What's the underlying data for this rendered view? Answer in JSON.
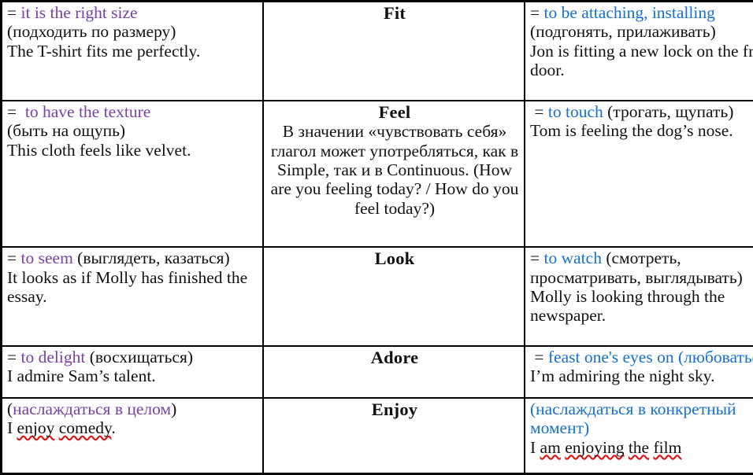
{
  "document": {
    "type": "table",
    "columns": 3,
    "rows": 5,
    "colors": {
      "purple": "#7b3fa6",
      "blue": "#1570cf",
      "text": "#111111",
      "border": "#000000",
      "spellcheck_underline": "#e01010",
      "background": "#ffffff"
    }
  },
  "rows": [
    {
      "verb": "Fit",
      "left": {
        "definition_prefix": "= ",
        "definition": "it is the right size",
        "translation": "(подходить по размеру)",
        "example": "The T-shirt fits me perfectly."
      },
      "right": {
        "definition_prefix": "= ",
        "definition": "to be attaching, installing",
        "translation": "(подгонять, прилаживать)",
        "example": "Jon is fitting a new lock on the front door."
      },
      "middle_note": ""
    },
    {
      "verb": "Feel",
      "left": {
        "definition_prefix": "=  ",
        "definition": "to have the texture",
        "translation": "(быть на ощупь)",
        "example": "This cloth feels like velvet."
      },
      "right": {
        "definition_prefix": " = ",
        "definition": "to touch",
        "translation": " (трогать, щупать)",
        "example": "Tom is feeling the dog’s nose."
      },
      "middle_note": "В значении «чувствовать себя» глагол может употребляться, как в Simple, так и в Continuous. (How are you feeling today? / How do you feel today?)"
    },
    {
      "verb": "Look",
      "left": {
        "definition_prefix": "= ",
        "definition": "to seem",
        "translation": " (выглядеть, казаться)",
        "example": "It looks as if Molly has finished the essay."
      },
      "right": {
        "definition_prefix": "= ",
        "definition": "to watch",
        "translation": " (смотреть, просматривать, выглядывать)",
        "example": "Molly is looking through the newspaper."
      },
      "middle_note": ""
    },
    {
      "verb": "Adore",
      "left": {
        "definition_prefix": "= ",
        "definition": "to delight",
        "translation": " (восхищаться)",
        "example": "I admire Sam’s talent."
      },
      "right": {
        "definition_prefix": " = ",
        "definition": "feast one's eyes on (любоваться)",
        "translation": "",
        "example": "I’m admiring the night sky."
      },
      "middle_note": ""
    },
    {
      "verb": "Enjoy",
      "left": {
        "definition_prefix": "(",
        "definition": "наслаждаться в целом",
        "translation": ")",
        "example_parts": [
          "I ",
          "enjoy",
          " ",
          "comedy",
          "."
        ]
      },
      "right": {
        "definition_prefix": "(",
        "definition": "наслаждаться в конкретный момент",
        "translation": ")",
        "example_parts": [
          "I ",
          "am",
          " ",
          "enjoying",
          " ",
          "the",
          " ",
          "film"
        ]
      },
      "middle_note": ""
    }
  ]
}
